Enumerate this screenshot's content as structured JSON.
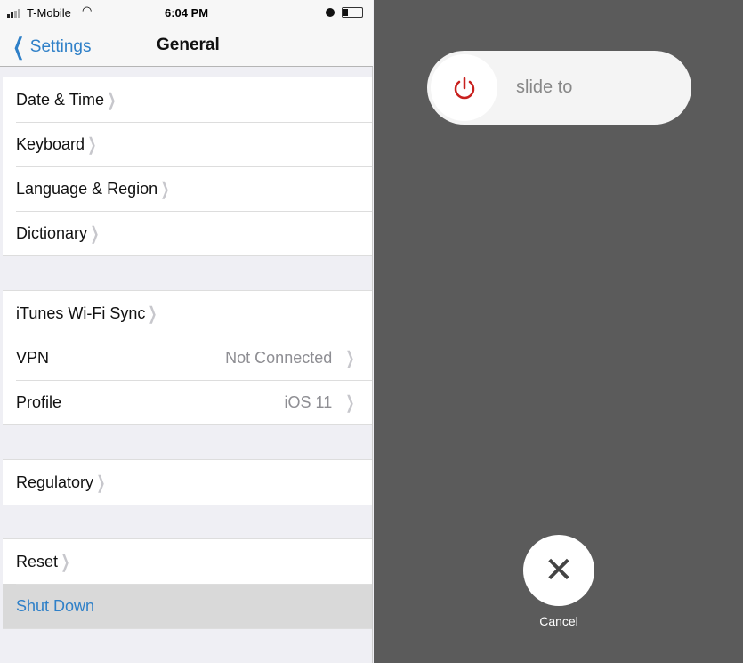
{
  "status": {
    "carrier": "T-Mobile",
    "time": "6:04 PM"
  },
  "nav": {
    "back_label": "Settings",
    "title": "General"
  },
  "groups": [
    [
      {
        "label": "Date & Time"
      },
      {
        "label": "Keyboard"
      },
      {
        "label": "Language & Region"
      },
      {
        "label": "Dictionary"
      }
    ],
    [
      {
        "label": "iTunes Wi-Fi Sync"
      },
      {
        "label": "VPN",
        "value": "Not Connected"
      },
      {
        "label": "Profile",
        "value": "iOS 11"
      }
    ],
    [
      {
        "label": "Regulatory"
      }
    ],
    [
      {
        "label": "Reset"
      },
      {
        "label": "Shut Down"
      }
    ]
  ],
  "power": {
    "slide_text": "slide to",
    "cancel_label": "Cancel",
    "power_color": "#c8201e"
  },
  "colors": {
    "accent": "#2f80c8"
  }
}
